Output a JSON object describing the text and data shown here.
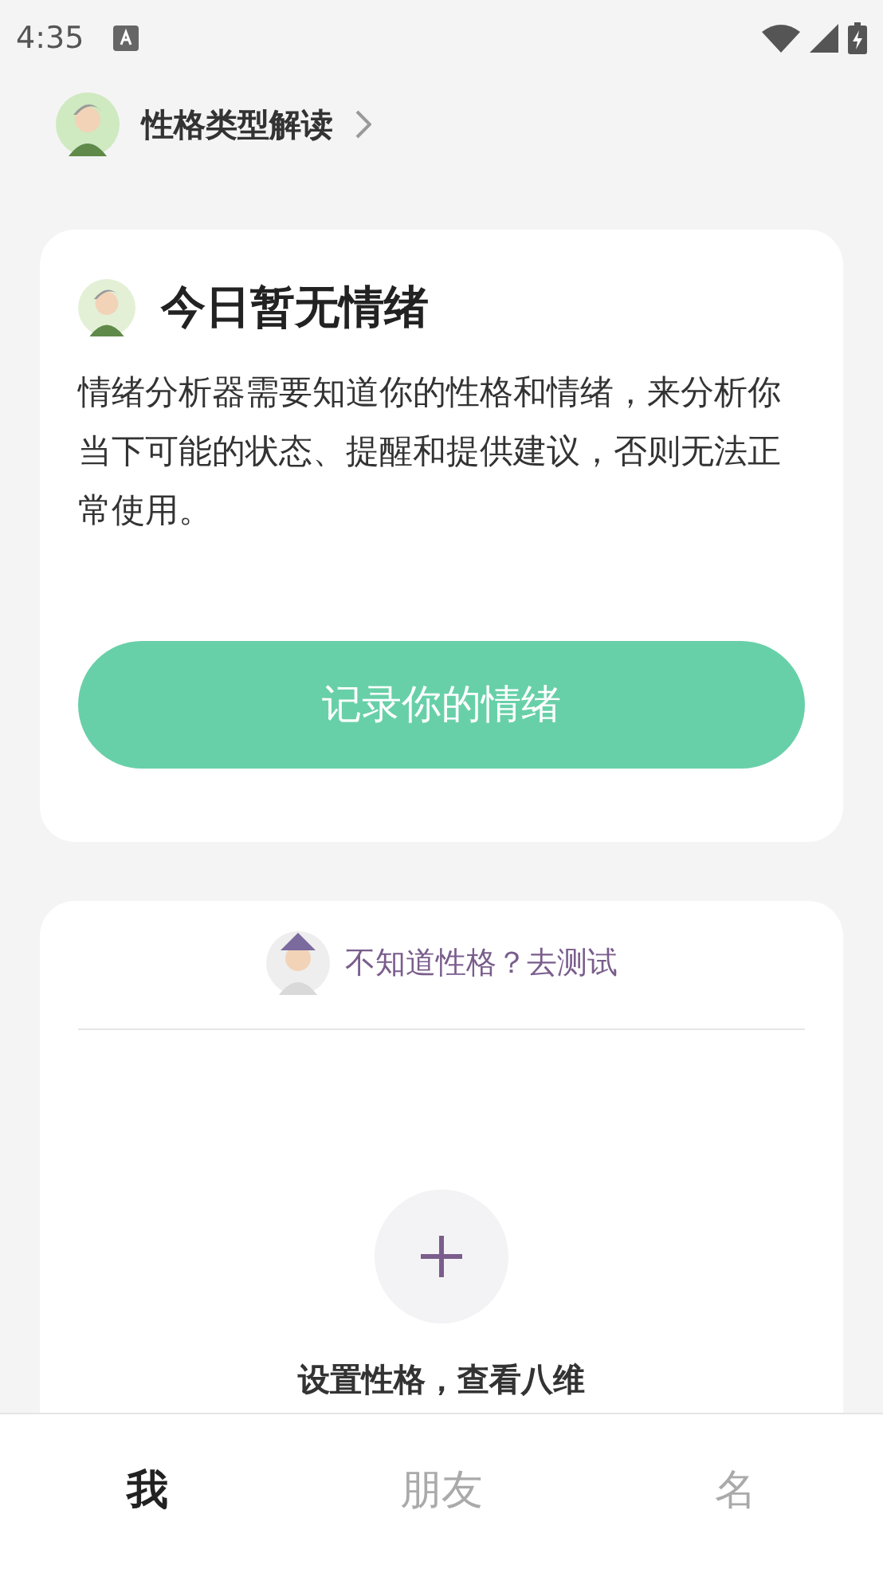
{
  "status_bar": {
    "time": "4:35"
  },
  "header": {
    "title": "性格类型解读"
  },
  "mood_card": {
    "title": "今日暂无情绪",
    "body": "情绪分析器需要知道你的性格和情绪，来分析你当下可能的状态、提醒和提供建议，否则无法正常使用。",
    "button": "记录你的情绪"
  },
  "personality_card": {
    "test_link": "不知道性格？去测试",
    "add_label": "设置性格，查看八维"
  },
  "tabs": [
    {
      "label": "我",
      "selected": true
    },
    {
      "label": "朋友",
      "selected": false
    },
    {
      "label": "名",
      "selected": false
    }
  ]
}
